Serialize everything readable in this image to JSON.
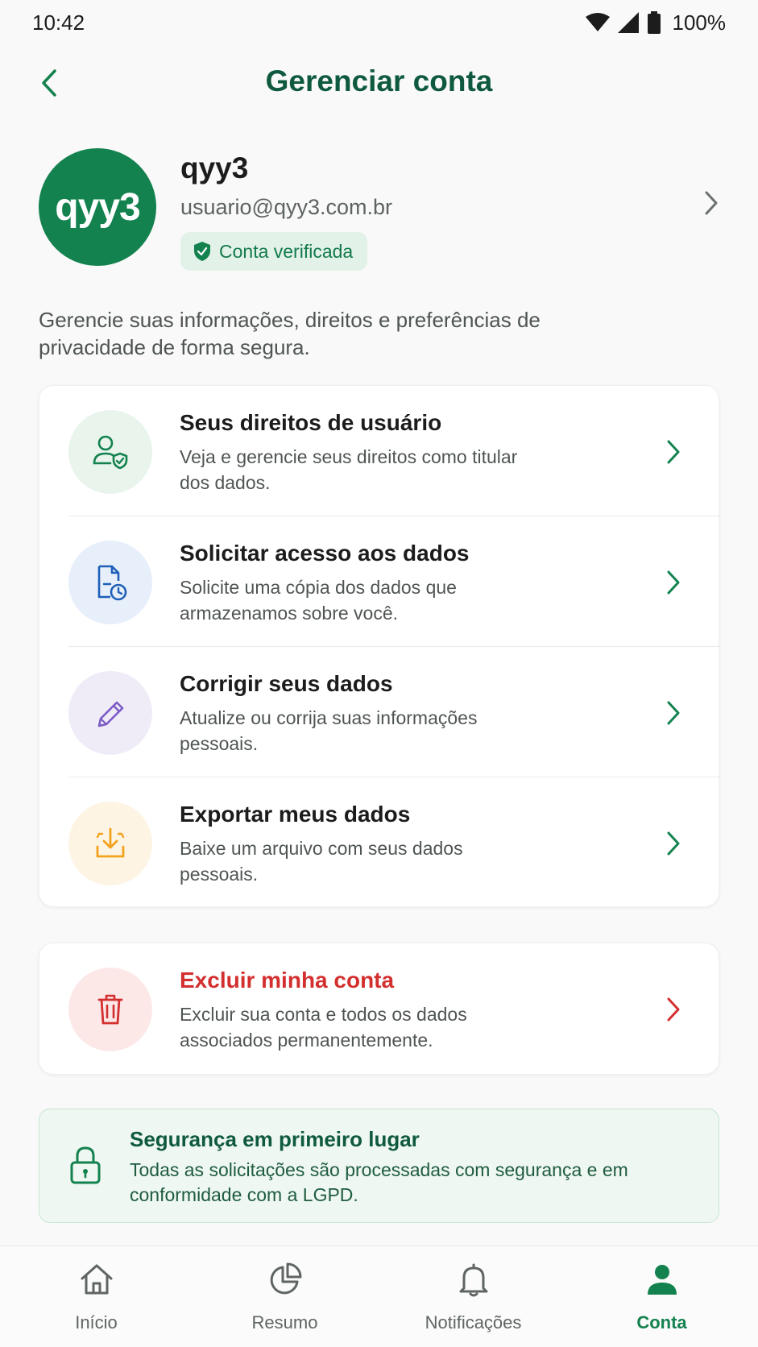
{
  "status_bar": {
    "time": "10:42",
    "battery": "100%"
  },
  "header": {
    "title": "Gerenciar conta"
  },
  "profile": {
    "avatar_text": "qyy3",
    "name": "qyy3",
    "email": "usuario@qyy3.com.br",
    "badge": "Conta verificada"
  },
  "intro": "Gerencie suas informações, direitos e preferências de privacidade de forma segura.",
  "options": [
    {
      "title": "Seus direitos de usuário",
      "desc": "Veja e gerencie seus direitos como titular dos dados.",
      "icon": "user-shield-icon"
    },
    {
      "title": "Solicitar acesso aos dados",
      "desc": "Solicite uma cópia dos dados que armazenamos sobre você.",
      "icon": "document-clock-icon"
    },
    {
      "title": "Corrigir seus dados",
      "desc": "Atualize ou corrija suas informações pessoais.",
      "icon": "pencil-icon"
    },
    {
      "title": "Exportar meus dados",
      "desc": "Baixe um arquivo com seus dados pessoais.",
      "icon": "download-icon"
    }
  ],
  "delete": {
    "title": "Excluir minha conta",
    "desc": "Excluir sua conta e todos os dados associados permanentemente.",
    "icon": "trash-icon"
  },
  "security": {
    "title": "Segurança em primeiro lugar",
    "desc": "Todas as solicitações são processadas com segurança e em conformidade com a LGPD.",
    "icon": "lock-icon"
  },
  "nav": [
    {
      "label": "Início",
      "icon": "home-icon",
      "active": false
    },
    {
      "label": "Resumo",
      "icon": "pie-chart-icon",
      "active": false
    },
    {
      "label": "Notificações",
      "icon": "bell-icon",
      "active": false
    },
    {
      "label": "Conta",
      "icon": "person-icon",
      "active": true
    }
  ],
  "colors": {
    "brand_green": "#13824f",
    "title_green": "#0f5a3e",
    "danger_red": "#d32f2f",
    "blue": "#1f5fb8",
    "purple": "#7c5cc4",
    "amber": "#f2a21d"
  }
}
